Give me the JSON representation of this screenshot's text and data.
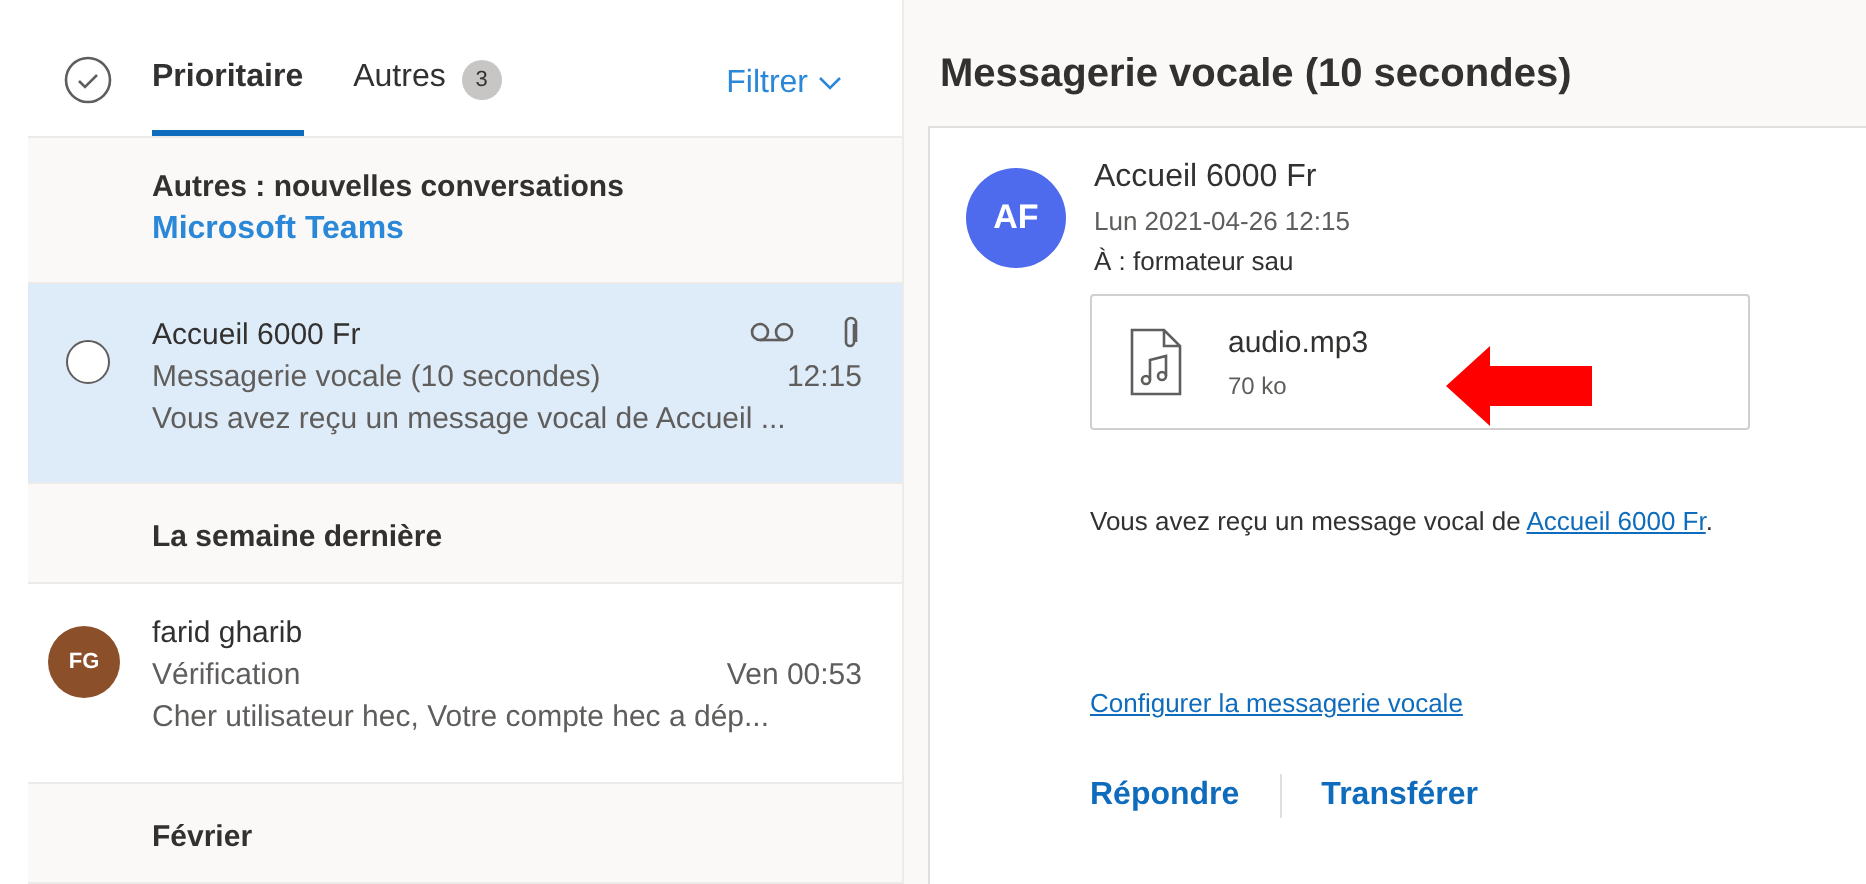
{
  "mail_list": {
    "tabs": [
      {
        "label": "Prioritaire",
        "selected": true
      },
      {
        "label": "Autres",
        "count": "3",
        "selected": false
      }
    ],
    "filter": "Filtrer",
    "items": [
      {
        "kind": "notice",
        "title": "Autres : nouvelles conversations",
        "link": "Microsoft Teams"
      },
      {
        "kind": "message",
        "selected": true,
        "sender": "Accueil 6000 Fr",
        "subject": "Messagerie vocale (10 secondes)",
        "time": "12:15",
        "preview": "Vous avez reçu un message vocal de Accueil ...",
        "voicemail": true,
        "attachment": true
      },
      {
        "kind": "group_header",
        "title": "La semaine dernière"
      },
      {
        "kind": "message",
        "selected": false,
        "avatar": {
          "initials": "FG",
          "color": "#8b4f2a"
        },
        "sender": "farid gharib",
        "subject": "Vérification",
        "time": "Ven 00:53",
        "preview": "Cher utilisateur hec, Votre compte hec a dép...",
        "voicemail": false,
        "attachment": false
      },
      {
        "kind": "group_header",
        "title": "Février"
      }
    ]
  },
  "reading_pane": {
    "title": "Messagerie vocale (10 secondes)",
    "avatar": {
      "initials": "AF",
      "color": "#4f6bed"
    },
    "sender": "Accueil 6000 Fr",
    "date": "Lun 2021-04-26 12:15",
    "to_label": "À :",
    "to": "formateur sau",
    "attachment": {
      "name": "audio.mp3",
      "size": "70 ko"
    },
    "body": {
      "text": "Vous avez reçu un message vocal de ",
      "link": "Accueil 6000 Fr",
      "end": "."
    },
    "setup_link": "Configurer la messagerie vocale",
    "actions": [
      "Répondre",
      "Transférer"
    ]
  }
}
